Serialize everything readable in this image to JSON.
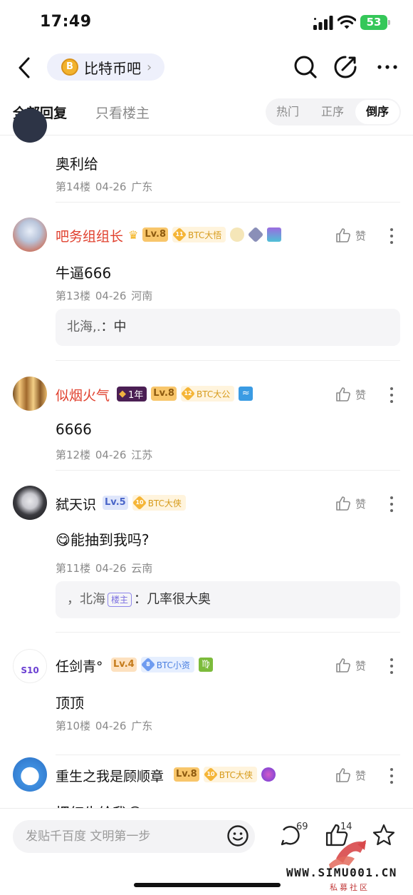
{
  "status": {
    "time": "17:49",
    "battery": "53"
  },
  "nav": {
    "forum_name": "比特币吧",
    "coin_glyph": "B"
  },
  "tabs": {
    "all": "全部回复",
    "op_only": "只看楼主",
    "hot": "热门",
    "asc": "正序",
    "desc": "倒序"
  },
  "posts": [
    {
      "content": "奥利给",
      "floor": "第14楼",
      "date": "04-26",
      "region": "广东"
    },
    {
      "username": "吧务组组长",
      "level": "Lv.8",
      "title_num": "11",
      "title": "BTC大悟",
      "content": "牛逼666",
      "floor": "第13楼",
      "date": "04-26",
      "region": "河南",
      "like": "赞",
      "reply": {
        "name": "北海,.",
        "text": "：中"
      }
    },
    {
      "username": "似烟火气",
      "year": "1年",
      "level": "Lv.8",
      "title_num": "12",
      "title": "BTC大公",
      "content": "6666",
      "floor": "第12楼",
      "date": "04-26",
      "region": "江苏",
      "like": "赞"
    },
    {
      "username": "弑天识",
      "level": "Lv.5",
      "title_num": "10",
      "title": "BTC大侠",
      "emoji": "😋",
      "content": "能抽到我吗?",
      "floor": "第11楼",
      "date": "04-26",
      "region": "云南",
      "like": "赞",
      "reply": {
        "name": "，北海",
        "tag": "楼主",
        "text": "：几率很大奥"
      }
    },
    {
      "username": "任剑青°",
      "level": "Lv.4",
      "title_num": "8",
      "title": "BTC小资",
      "content": "顶顶",
      "floor": "第10楼",
      "date": "04-26",
      "region": "广东",
      "like": "赞",
      "avatar_text": "S10"
    },
    {
      "username": "重生之我是顾顺章",
      "level": "Lv.8",
      "title_num": "10",
      "title": "BTC大侠",
      "like": "赞",
      "content": "把红牛给我😂"
    }
  ],
  "bottom": {
    "placeholder": "发贴千百度 文明第一步",
    "comments": "69",
    "likes": "14"
  },
  "watermark": {
    "url": "WWW.SIMU001.CN",
    "name": "私募社区"
  }
}
